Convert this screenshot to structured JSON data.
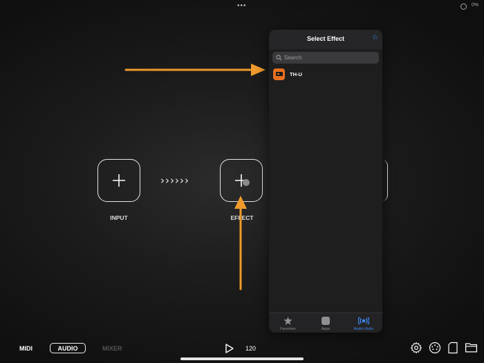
{
  "topbar": {
    "dots": "•••",
    "status": "0%"
  },
  "chain": {
    "chevrons": "››››››",
    "input_label": "INPUT",
    "effect_label": "EFFECT"
  },
  "popover": {
    "title": "Select Effect",
    "search_placeholder": "Search",
    "results": [
      {
        "label": "TH-U",
        "icon": "th-u-app-icon"
      }
    ],
    "tabs": [
      {
        "label": "Favorites",
        "icon": "star-icon",
        "active": false
      },
      {
        "label": "Apps",
        "icon": "apps-icon",
        "active": false
      },
      {
        "label": "Audio Units",
        "icon": "audio-units-icon",
        "active": true
      }
    ]
  },
  "toolbar": {
    "midi": "MIDI",
    "audio": "AUDIO",
    "mixer": "MIXER",
    "tempo": "120"
  },
  "colors": {
    "accent": "#3d8cff",
    "arrow": "#f09a2c",
    "app_icon": "#e6701f"
  }
}
